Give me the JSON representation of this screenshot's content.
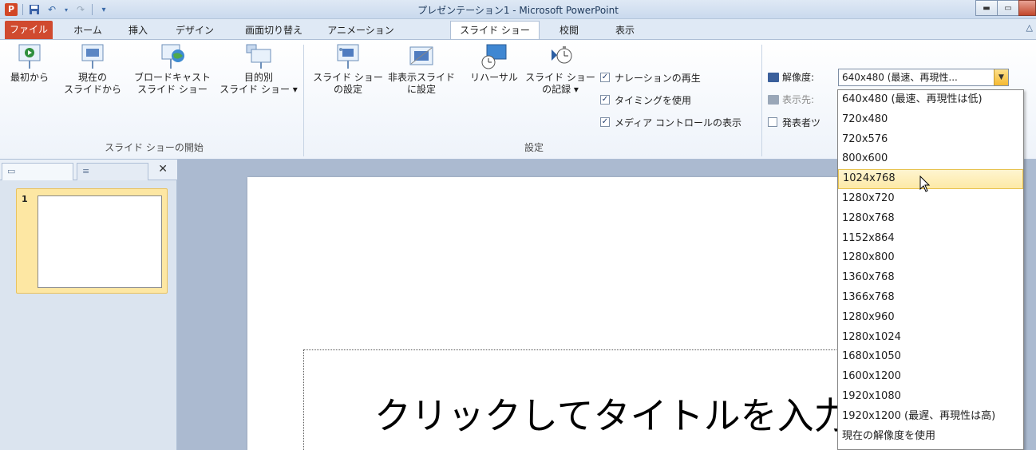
{
  "window": {
    "app_icon": "P",
    "title": "プレゼンテーション1 - Microsoft PowerPoint"
  },
  "quick_access": {
    "save_icon": "save-icon",
    "undo_icon": "undo-icon",
    "redo_icon": "redo-icon",
    "customize_icon": "customize-qat-icon"
  },
  "tabs": [
    {
      "label": "ファイル"
    },
    {
      "label": "ホーム"
    },
    {
      "label": "挿入"
    },
    {
      "label": "デザイン"
    },
    {
      "label": "画面切り替え"
    },
    {
      "label": "アニメーション"
    },
    {
      "label": "スライド ショー"
    },
    {
      "label": "校閲"
    },
    {
      "label": "表示"
    }
  ],
  "ribbon": {
    "start_group": {
      "label": "スライド ショーの開始",
      "buttons": [
        {
          "line1": "最初から",
          "line2": ""
        },
        {
          "line1": "現在の",
          "line2": "スライドから"
        },
        {
          "line1": "ブロードキャスト",
          "line2": "スライド ショー"
        },
        {
          "line1": "目的別",
          "line2": "スライド ショー ▾"
        }
      ]
    },
    "setup_group": {
      "label": "設定",
      "buttons": [
        {
          "line1": "スライド ショー",
          "line2": "の設定"
        },
        {
          "line1": "非表示スライド",
          "line2": "に設定"
        },
        {
          "line1": "リハーサル",
          "line2": ""
        },
        {
          "line1": "スライド ショー",
          "line2": "の記録 ▾"
        }
      ],
      "checks": [
        {
          "label": "ナレーションの再生",
          "checked": true
        },
        {
          "label": "タイミングを使用",
          "checked": true
        },
        {
          "label": "メディア コントロールの表示",
          "checked": true
        }
      ]
    },
    "monitors_group": {
      "resolution_label": "解像度:",
      "resolution_value": "640x480 (最速、再現性...",
      "display_on_label": "表示先:",
      "presenter_view_label": "発表者ツ"
    }
  },
  "left_panel": {
    "slide_number": "1",
    "close_icon": "close-icon"
  },
  "slide": {
    "title_placeholder": "クリックしてタイトルを入力"
  },
  "resolution_dropdown": {
    "hovered_index": 4,
    "options": [
      "640x480 (最速、再現性は低)",
      "720x480",
      "720x576",
      "800x600",
      "1024x768",
      "1280x720",
      "1280x768",
      "1152x864",
      "1280x800",
      "1360x768",
      "1366x768",
      "1280x960",
      "1280x1024",
      "1680x1050",
      "1600x1200",
      "1920x1080",
      "1920x1200 (最遅、再現性は高)",
      "現在の解像度を使用"
    ]
  }
}
